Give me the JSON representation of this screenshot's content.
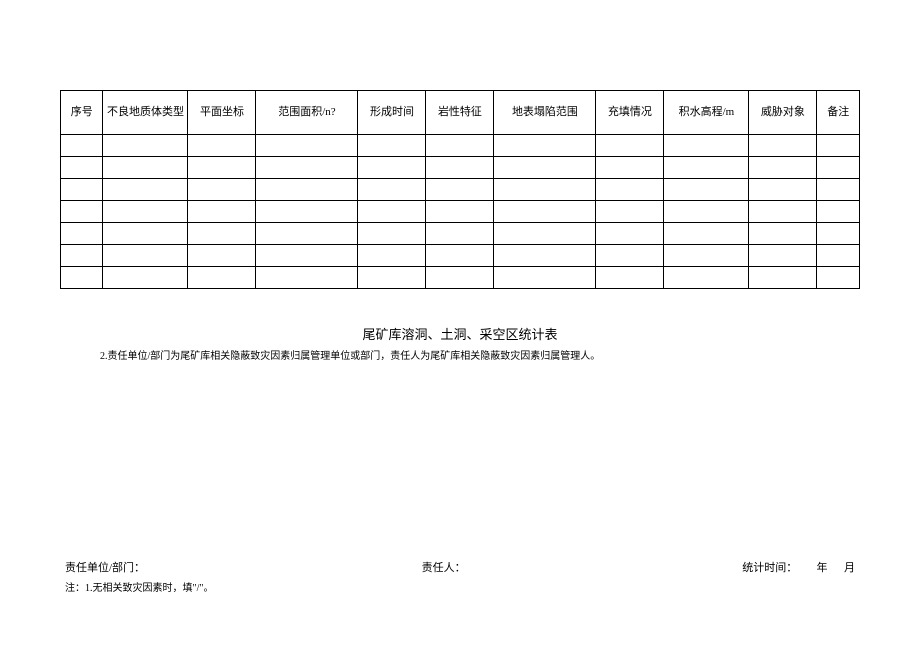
{
  "table": {
    "headers": [
      "序号",
      "不良地质体类型",
      "平面坐标",
      "范围面积/n?",
      "形成时间",
      "岩性特征",
      "地表塌陷范围",
      "充填情况",
      "积水高程/m",
      "威胁对象",
      "备注"
    ],
    "rowCount": 7
  },
  "subtitle": "尾矿库溶洞、土洞、采空区统计表",
  "noteMid": "2.责任单位/部门为尾矿库相关隐蔽致灾因素归属管理单位或部门，责任人为尾矿库相关隐蔽致灾因素归属管理人。",
  "footer": {
    "dept": "责任单位/部门：",
    "person": "责任人：",
    "time": "统计时间：",
    "year": "年",
    "month": "月"
  },
  "footerNote": "注：1.无相关致灾因素时，填\"/\"。"
}
